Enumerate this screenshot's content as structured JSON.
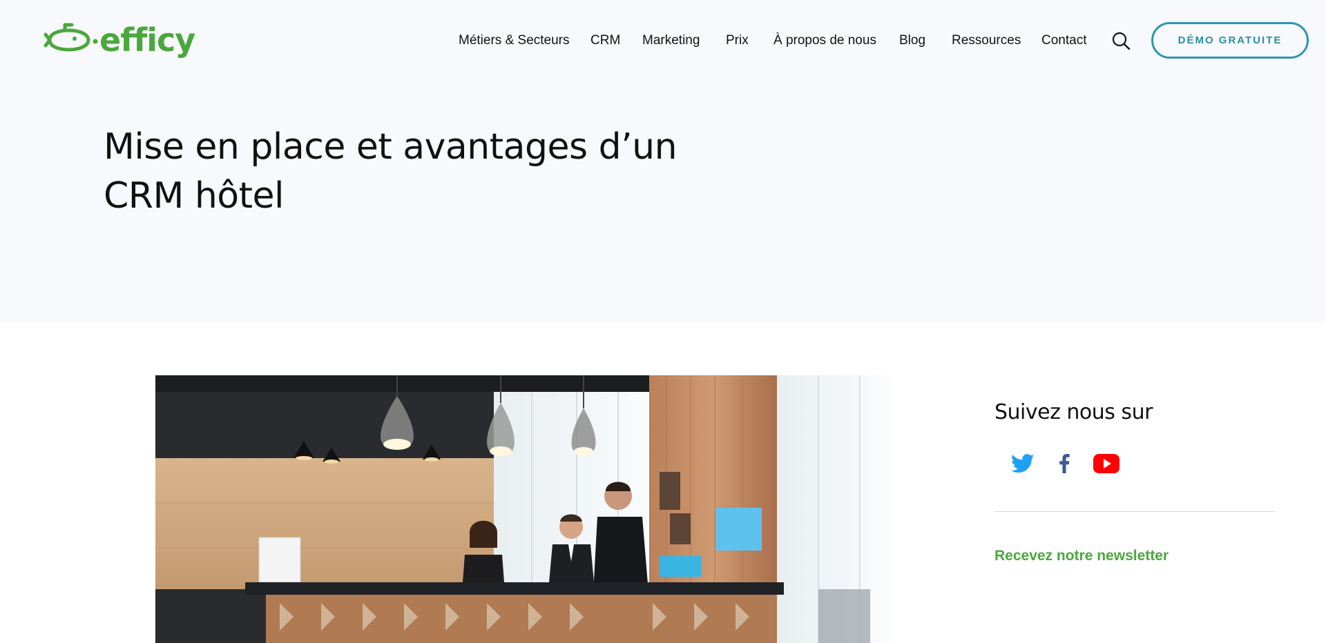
{
  "brand": {
    "name": "efficy",
    "logo_icon": "submarine-logo-icon",
    "color": "#4aa73c"
  },
  "nav": {
    "items": [
      {
        "label": "Métiers & Secteurs"
      },
      {
        "label": "CRM"
      },
      {
        "label": "Marketing"
      },
      {
        "label": "Prix"
      },
      {
        "label": "À propos de nous"
      },
      {
        "label": "Blog"
      },
      {
        "label": "Ressources"
      },
      {
        "label": "Contact"
      }
    ],
    "search_icon": "search-icon",
    "cta_label": "DÉMO GRATUITE",
    "cta_color": "#2a97b0"
  },
  "hero": {
    "title_line1": "Mise en place et avantages d’un",
    "title_line2": "CRM hôtel",
    "background": "#f8f9fc"
  },
  "article": {
    "image_description_icon": "hotel-reception-photo"
  },
  "sidebar": {
    "follow_title": "Suivez nous sur",
    "social": [
      {
        "name": "twitter-icon",
        "color": "#1da1f2"
      },
      {
        "name": "facebook-icon",
        "color": "#3b5998"
      },
      {
        "name": "youtube-icon",
        "color": "#ff0000"
      }
    ],
    "newsletter_label": "Recevez notre newsletter"
  }
}
